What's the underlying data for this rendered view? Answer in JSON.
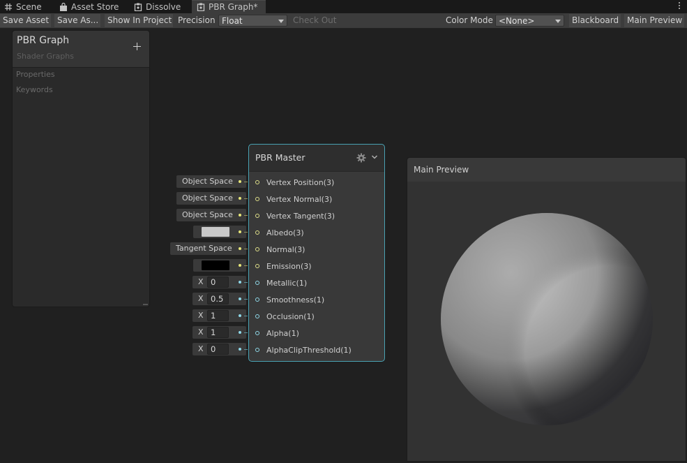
{
  "tabs": [
    {
      "label": "Scene",
      "icon": "grid-icon"
    },
    {
      "label": "Asset Store",
      "icon": "shopping-bag-icon"
    },
    {
      "label": "Dissolve",
      "icon": "shader-graph-icon"
    },
    {
      "label": "PBR Graph*",
      "icon": "shader-graph-icon",
      "active": true
    }
  ],
  "toolbar": {
    "save_asset": "Save Asset",
    "save_as": "Save As...",
    "show_in_project": "Show In Project",
    "precision_label": "Precision",
    "precision_value": "Float",
    "check_out": "Check Out",
    "color_mode_label": "Color Mode",
    "color_mode_value": "<None>",
    "blackboard": "Blackboard",
    "main_preview": "Main Preview"
  },
  "blackboard": {
    "title": "PBR Graph",
    "subtitle": "Shader Graphs",
    "sections": [
      "Properties",
      "Keywords"
    ]
  },
  "node": {
    "title": "PBR Master",
    "slots": [
      {
        "label": "Vertex Position(3)",
        "input": "Object Space",
        "kind": "dropdown",
        "port": "vector"
      },
      {
        "label": "Vertex Normal(3)",
        "input": "Object Space",
        "kind": "dropdown",
        "port": "vector"
      },
      {
        "label": "Vertex Tangent(3)",
        "input": "Object Space",
        "kind": "dropdown",
        "port": "vector"
      },
      {
        "label": "Albedo(3)",
        "input": "",
        "kind": "color",
        "color": "#c8c8c8",
        "port": "vector"
      },
      {
        "label": "Normal(3)",
        "input": "Tangent Space",
        "kind": "dropdown",
        "port": "vector"
      },
      {
        "label": "Emission(3)",
        "input": "",
        "kind": "color",
        "color": "#000000",
        "port": "vector"
      },
      {
        "label": "Metallic(1)",
        "input": "0",
        "kind": "float",
        "axis": "X",
        "port": "float"
      },
      {
        "label": "Smoothness(1)",
        "input": "0.5",
        "kind": "float",
        "axis": "X",
        "port": "float"
      },
      {
        "label": "Occlusion(1)",
        "input": "1",
        "kind": "float",
        "axis": "X",
        "port": "float"
      },
      {
        "label": "Alpha(1)",
        "input": "1",
        "kind": "float",
        "axis": "X",
        "port": "float"
      },
      {
        "label": "AlphaClipThreshold(1)",
        "input": "0",
        "kind": "float",
        "axis": "X",
        "port": "float"
      }
    ]
  },
  "preview": {
    "title": "Main Preview"
  },
  "colors": {
    "accent_port_vector": "#e0e08a",
    "accent_port_float": "#8fd8e8",
    "node_selected_border": "#4aa3b4"
  }
}
